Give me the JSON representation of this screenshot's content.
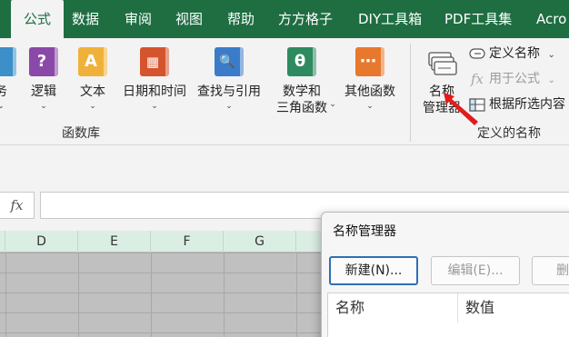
{
  "tabs": [
    {
      "label": "公式",
      "active": true
    },
    {
      "label": "数据"
    },
    {
      "label": "审阅"
    },
    {
      "label": "视图"
    },
    {
      "label": "帮助"
    },
    {
      "label": "方方格子"
    },
    {
      "label": "DIY工具箱"
    },
    {
      "label": "PDF工具集"
    },
    {
      "label": "Acro"
    }
  ],
  "ribbon": {
    "function_library": {
      "group_label": "函数库",
      "buttons": [
        {
          "label": "务",
          "icon": "financial-book-icon"
        },
        {
          "label": "逻辑",
          "icon": "logical-book-icon",
          "glyph": "?"
        },
        {
          "label": "文本",
          "icon": "text-book-icon",
          "glyph": "A"
        },
        {
          "label": "日期和时间",
          "icon": "date-time-book-icon",
          "glyph": "▦"
        },
        {
          "label": "查找与引用",
          "icon": "lookup-reference-book-icon",
          "glyph": "🔍"
        },
        {
          "label_line1": "数学和",
          "label_line2": "三角函数",
          "icon": "math-trig-book-icon",
          "glyph": "θ"
        },
        {
          "label": "其他函数",
          "icon": "more-functions-book-icon",
          "glyph": "⋯"
        }
      ]
    },
    "defined_names": {
      "group_label": "定义的名称",
      "name_manager": {
        "line1": "名称",
        "line2": "管理器",
        "icon": "name-manager-icon"
      },
      "define_name": {
        "label": "定义名称",
        "icon": "define-name-icon"
      },
      "use_in_formula": {
        "label": "用于公式",
        "icon": "fx-icon",
        "disabled": true
      },
      "create_from_selection": {
        "label": "根据所选内容",
        "icon": "create-from-selection-icon"
      }
    }
  },
  "formula_bar": {
    "fx": "fx",
    "value": ""
  },
  "columns": [
    "D",
    "E",
    "F",
    "G"
  ],
  "dialog": {
    "title": "名称管理器",
    "buttons": {
      "new": "新建(N)...",
      "edit": "编辑(E)...",
      "delete": "删"
    },
    "list_headers": [
      "名称",
      "数值"
    ]
  },
  "colors": {
    "tab_bar": "#1e6e42",
    "header_fill": "#dbeee3",
    "annotation_arrow": "#e21b1b",
    "book_financial": "#3c8fc9",
    "book_logical": "#8a49a8",
    "book_text": "#f0b13a",
    "book_date": "#d4542d",
    "book_lookup": "#3a7cc9",
    "book_math": "#2e8b5f",
    "book_more": "#e8782d"
  }
}
